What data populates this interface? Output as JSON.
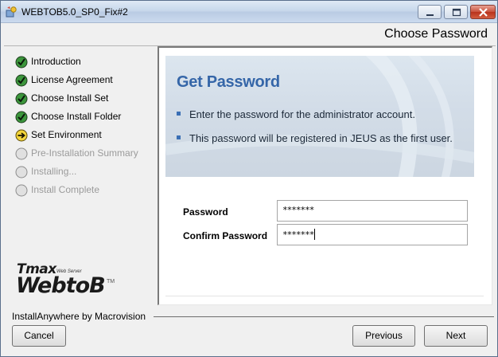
{
  "window": {
    "title": "WEBTOB5.0_SP0_Fix#2",
    "app_icon": "installer-icon",
    "controls": [
      "minimize-icon",
      "maximize-icon",
      "close-icon"
    ]
  },
  "header": {
    "title": "Choose Password"
  },
  "steps": [
    {
      "label": "Introduction",
      "status": "complete",
      "icon": "check-icon"
    },
    {
      "label": "License Agreement",
      "status": "complete",
      "icon": "check-icon"
    },
    {
      "label": "Choose Install Set",
      "status": "complete",
      "icon": "check-icon"
    },
    {
      "label": "Choose Install Folder",
      "status": "complete",
      "icon": "check-icon"
    },
    {
      "label": "Set Environment",
      "status": "current",
      "icon": "arrow-right-icon"
    },
    {
      "label": "Pre-Installation Summary",
      "status": "pending",
      "icon": "circle-icon"
    },
    {
      "label": "Installing...",
      "status": "pending",
      "icon": "circle-icon"
    },
    {
      "label": "Install Complete",
      "status": "pending",
      "icon": "circle-icon"
    }
  ],
  "logo": {
    "brand": "Tmax",
    "product": "WebtoB",
    "subtitle": "Web Server",
    "trademark": "TM"
  },
  "banner": {
    "title": "Get Password",
    "bullets": [
      "Enter the password for the administrator account.",
      "This password will be registered in JEUS as the first user."
    ]
  },
  "form": {
    "password_label": "Password",
    "password_value": "*******",
    "confirm_label": "Confirm Password",
    "confirm_value": "*******"
  },
  "footer": {
    "vendor": "InstallAnywhere by Macrovision",
    "cancel_label": "Cancel",
    "previous_label": "Previous",
    "next_label": "Next"
  },
  "colors": {
    "accent": "#3566a8",
    "complete": "#2f8a2f",
    "current": "#e8c31a",
    "pending": "#c8c8c8"
  }
}
